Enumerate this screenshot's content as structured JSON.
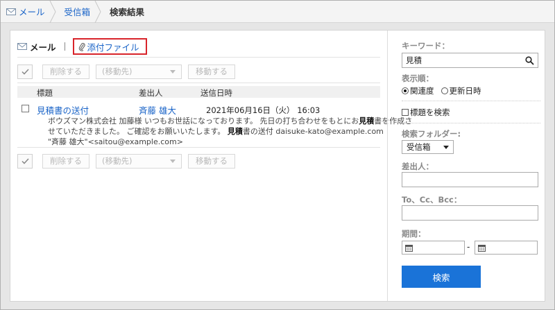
{
  "breadcrumb": [
    "メール",
    "受信箱",
    "検索結果"
  ],
  "tabs": {
    "mail": "メール",
    "attachments": "添付ファイル"
  },
  "toolbar": {
    "delete_label": "削除する",
    "dest_placeholder": "(移動先)",
    "move_label": "移動する"
  },
  "list": {
    "columns": {
      "subject": "標題",
      "sender": "差出人",
      "sent_date": "送信日時"
    },
    "rows": [
      {
        "subject": "見積書の送付",
        "sender": "斉藤 雄大",
        "date": "2021年06月16日（火） 16:03",
        "snippet_line1_a": "ボウズマン株式会社 加藤様 いつもお世話になっております。 先日の打ち合わせをもとにお",
        "snippet_line1_b": "見積",
        "snippet_line1_c": "書を作成さ",
        "snippet_line2_a": "せていただきました。 ご確認をお願いいたします。 ",
        "snippet_line2_b": "見積",
        "snippet_line2_c": "書の送付 daisuke-kato@example.com",
        "snippet_line3": "\"斉藤 雄大\"<saitou@example.com>"
      }
    ]
  },
  "search": {
    "keyword_label": "キーワード：",
    "keyword_value": "見積",
    "order_label": "表示順：",
    "order_relevance": "関連度",
    "order_updated": "更新日時",
    "subject_only": "標題を検索",
    "folder_label": "検索フォルダー:",
    "folder_value": "受信箱",
    "sender_label": "差出人：",
    "to_label": "To、Cc、Bcc：",
    "period_label": "期間：",
    "dash": "-",
    "button": "検索"
  },
  "colors": {
    "link": "#1a64c8",
    "accent": "#1a73d8",
    "highlight_border": "#d8232a"
  }
}
